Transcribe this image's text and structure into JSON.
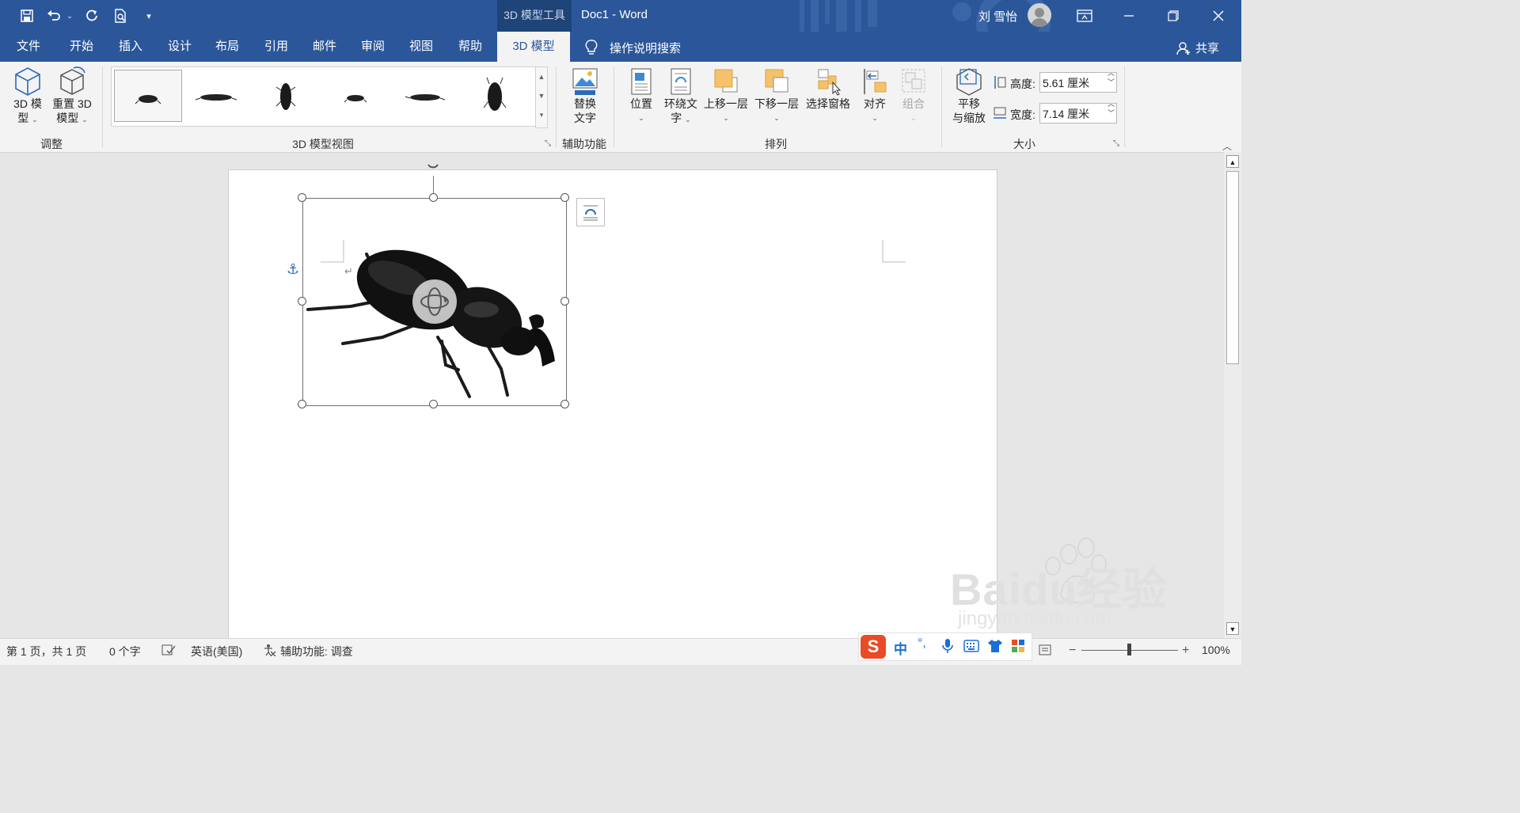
{
  "titlebar": {
    "context_label": "3D 模型工具",
    "doc_title": "Doc1  -  Word",
    "user_name": "刘 雪怡"
  },
  "tabs": [
    "文件",
    "开始",
    "插入",
    "设计",
    "布局",
    "引用",
    "邮件",
    "审阅",
    "视图",
    "帮助",
    "3D 模型"
  ],
  "search_label": "操作说明搜索",
  "share_label": "共享",
  "ribbon": {
    "adjust": {
      "model_btn": [
        "3D 模",
        "型"
      ],
      "reset_btn": [
        "重置 3D",
        "模型"
      ],
      "group_label": "调整"
    },
    "views_group_label": "3D 模型视图",
    "access": {
      "alt_text_btn": [
        "替换",
        "文字"
      ],
      "group_label": "辅助功能"
    },
    "arrange": {
      "position_btn": "位置",
      "wrap_btn": [
        "环绕文",
        "字"
      ],
      "forward_btn": "上移一层",
      "backward_btn": "下移一层",
      "pane_btn": "选择窗格",
      "align_btn": "对齐",
      "group_btn": "组合",
      "group_label": "排列"
    },
    "size": {
      "pan_btn": [
        "平移",
        "与缩放"
      ],
      "height_label": "高度:",
      "height_value": "5.61 厘米",
      "width_label": "宽度:",
      "width_value": "7.14 厘米",
      "group_label": "大小"
    }
  },
  "status": {
    "page": "第 1 页，共 1 页",
    "words": "0 个字",
    "language": "英语(美国)",
    "accessibility": "辅助功能: 调查",
    "zoom": "100%"
  },
  "ime": {
    "lang": "中"
  },
  "watermark": {
    "logo": "Baidu经验",
    "url": "jingyan.baidu.com"
  }
}
